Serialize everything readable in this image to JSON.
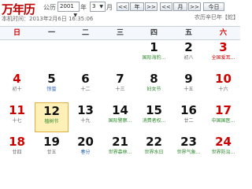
{
  "app": {
    "logo": "万年历"
  },
  "controls": {
    "calendar_label": "公历",
    "year": "2001",
    "year_label": "年",
    "month": "3",
    "month_label": "月",
    "prev_year": "<<",
    "year_nav": "年",
    "next_year": ">>",
    "prev_month": "<<",
    "month_nav": "月",
    "next_month": ">>",
    "today": "今日"
  },
  "status": {
    "time": "本机时间：2013年2月6日 16:35:06",
    "lunar": "农历辛巳年【蛇】"
  },
  "weekdays": [
    "日",
    "一",
    "二",
    "三",
    "四",
    "五",
    "六"
  ],
  "weeks": [
    [
      {
        "day": "",
        "sub": ""
      },
      {
        "day": "",
        "sub": ""
      },
      {
        "day": "",
        "sub": ""
      },
      {
        "day": "",
        "sub": ""
      },
      {
        "day": "1",
        "sub": "国际海豹..."
      },
      {
        "day": "2",
        "sub": "初八"
      },
      {
        "day": "3",
        "sub": "全国爱耳..."
      }
    ],
    [
      {
        "day": "4",
        "sub": "初十"
      },
      {
        "day": "5",
        "sub": "惊蛰"
      },
      {
        "day": "6",
        "sub": "十二"
      },
      {
        "day": "7",
        "sub": "十三"
      },
      {
        "day": "8",
        "sub": "妇女节"
      },
      {
        "day": "9",
        "sub": "十五"
      },
      {
        "day": "10",
        "sub": "十六"
      }
    ],
    [
      {
        "day": "11",
        "sub": "十七"
      },
      {
        "day": "12",
        "sub": "植树节"
      },
      {
        "day": "13",
        "sub": "十九"
      },
      {
        "day": "14",
        "sub": "国际警察..."
      },
      {
        "day": "15",
        "sub": "消费者权..."
      },
      {
        "day": "16",
        "sub": "廿二"
      },
      {
        "day": "17",
        "sub": "中国国医..."
      }
    ],
    [
      {
        "day": "18",
        "sub": "廿四"
      },
      {
        "day": "19",
        "sub": "廿五"
      },
      {
        "day": "20",
        "sub": "春分"
      },
      {
        "day": "21",
        "sub": "世界森林..."
      },
      {
        "day": "22",
        "sub": "世界水日"
      },
      {
        "day": "23",
        "sub": "世界气象..."
      },
      {
        "day": "24",
        "sub": "世界防治..."
      }
    ]
  ],
  "colors": {
    "weekend": "#d00000",
    "festival": "#2a8a2a",
    "solar_term": "#2a66b5",
    "today_bg": "#fff0b8"
  }
}
